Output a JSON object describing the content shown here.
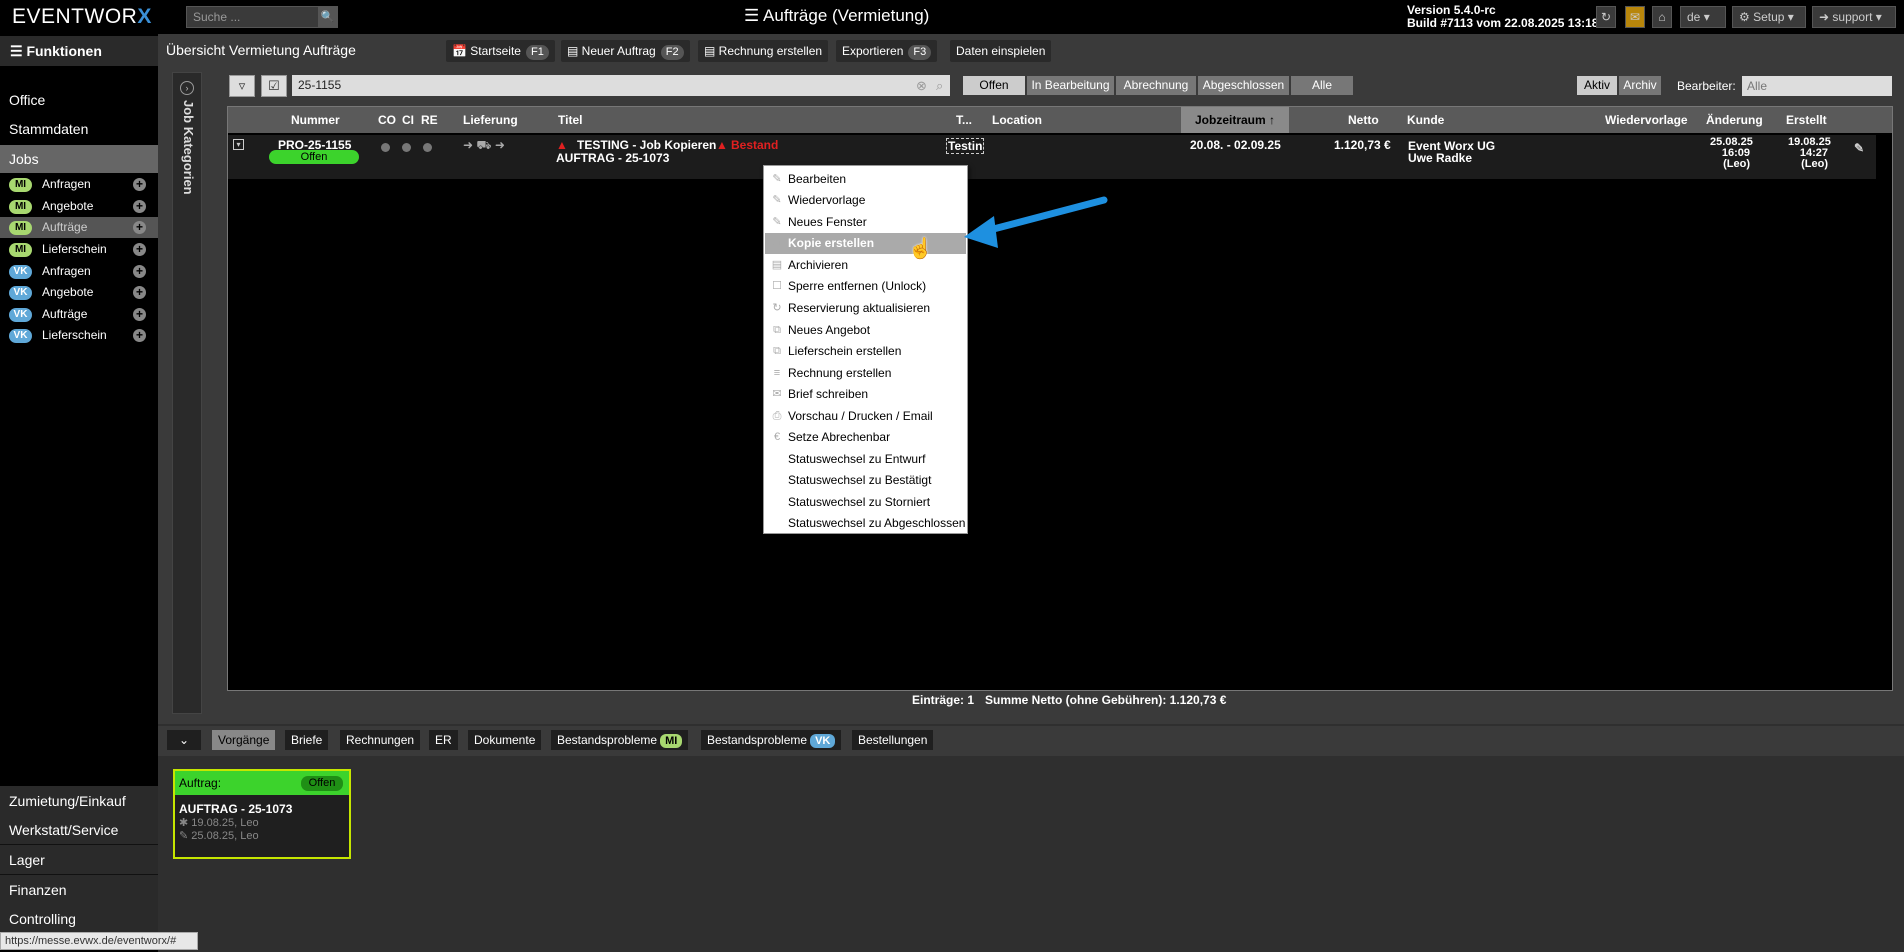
{
  "app": {
    "logo_text": "EVENTWOR",
    "logo_x": "X",
    "search_placeholder": "Suche ...",
    "title": "Aufträge (Vermietung)",
    "version": "Version 5.4.0-rc",
    "build": "Build #7113 vom 22.08.2025 13:18",
    "lang": "de",
    "setup": "Setup",
    "user": "support"
  },
  "sidebar": {
    "funktionen": "Funktionen",
    "office": "Office",
    "stammdaten": "Stammdaten",
    "jobs": "Jobs",
    "items": [
      {
        "tag": "MI",
        "label": "Anfragen"
      },
      {
        "tag": "MI",
        "label": "Angebote"
      },
      {
        "tag": "MI",
        "label": "Aufträge"
      },
      {
        "tag": "MI",
        "label": "Lieferschein"
      },
      {
        "tag": "VK",
        "label": "Anfragen"
      },
      {
        "tag": "VK",
        "label": "Angebote"
      },
      {
        "tag": "VK",
        "label": "Aufträge"
      },
      {
        "tag": "VK",
        "label": "Lieferschein"
      }
    ],
    "bottom": [
      "Zumietung/Einkauf",
      "Werkstatt/Service",
      "Lager",
      "Finanzen",
      "Controlling"
    ]
  },
  "header": {
    "title": "Übersicht Vermietung Aufträge",
    "buttons": [
      {
        "label": "Startseite",
        "key": "F1"
      },
      {
        "label": "Neuer Auftrag",
        "key": "F2"
      },
      {
        "label": "Rechnung erstellen",
        "key": ""
      },
      {
        "label": "Exportieren",
        "key": "F3"
      },
      {
        "label": "Daten einspielen",
        "key": ""
      }
    ]
  },
  "jobcat": "Job Kategorien",
  "filter": {
    "value": "25-1155",
    "segments": [
      "Offen",
      "In Bearbeitung",
      "Abrechnung",
      "Abgeschlossen",
      "Alle"
    ],
    "active_segment": "Offen",
    "aktiv": "Aktiv",
    "archiv": "Archiv",
    "bearbeiter_label": "Bearbeiter:",
    "bearbeiter_value": "Alle"
  },
  "table": {
    "headers": [
      "Nummer",
      "CO",
      "CI",
      "RE",
      "Lieferung",
      "Titel",
      "T...",
      "Location",
      "Jobzeitraum",
      "Netto",
      "Kunde",
      "Wiedervorlage",
      "Änderung",
      "Erstellt"
    ],
    "row": {
      "nummer": "PRO-25-1155",
      "status": "Offen",
      "titel": "TESTING - Job Kopieren",
      "warn": "Bestand",
      "titel2": "AUFTRAG - 25-1073",
      "t": "Testin",
      "zeitraum": "20.08. - 02.09.25",
      "netto": "1.120,73 €",
      "kunde1": "Event Worx UG",
      "kunde2": "Uwe Radke",
      "aenderung": [
        "25.08.25",
        "16:09",
        "(Leo)"
      ],
      "erstellt": [
        "19.08.25",
        "14:27",
        "(Leo)"
      ]
    }
  },
  "footer": {
    "eintraege": "Einträge: 1",
    "summe": "Summe Netto (ohne Gebühren): 1.120,73 €"
  },
  "context_menu": [
    "Bearbeiten",
    "Wiedervorlage",
    "Neues Fenster",
    "Kopie erstellen",
    "Archivieren",
    "Sperre entfernen (Unlock)",
    "Reservierung aktualisieren",
    "Neues Angebot",
    "Lieferschein erstellen",
    "Rechnung erstellen",
    "Brief schreiben",
    "Vorschau / Drucken / Email",
    "Setze Abrechenbar",
    "Statuswechsel zu Entwurf",
    "Statuswechsel zu Bestätigt",
    "Statuswechsel zu Storniert",
    "Statuswechsel zu Abgeschlossen"
  ],
  "bottom_tabs": [
    {
      "label": "Vorgänge"
    },
    {
      "label": "Briefe"
    },
    {
      "label": "Rechnungen"
    },
    {
      "label": "ER"
    },
    {
      "label": "Dokumente"
    },
    {
      "label": "Bestandsprobleme",
      "tag": "MI"
    },
    {
      "label": "Bestandsprobleme",
      "tag": "VK"
    },
    {
      "label": "Bestellungen"
    }
  ],
  "card": {
    "head": "Auftrag:",
    "status": "Offen",
    "title": "AUFTRAG - 25-1073",
    "line1": "19.08.25, Leo",
    "line2": "25.08.25, Leo"
  },
  "url": "https://messe.evwx.de/eventworx/#",
  "colors": {
    "mi_tag": "#a8d870",
    "vk_tag": "#5fa8d8",
    "status_green": "#3cd32c",
    "arrow_blue": "#1e90e0",
    "card_border": "#c5e600"
  }
}
